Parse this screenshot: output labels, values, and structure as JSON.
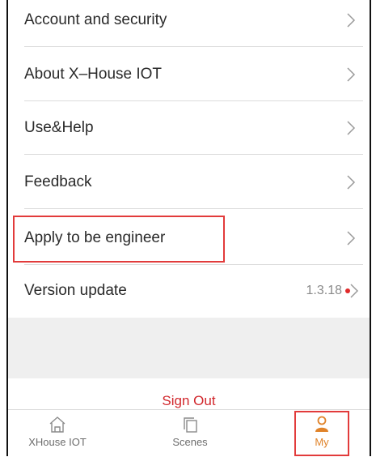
{
  "menu": {
    "items": [
      {
        "label": "Account and security"
      },
      {
        "label": "About X–House IOT"
      },
      {
        "label": "Use&Help"
      },
      {
        "label": "Feedback"
      },
      {
        "label": "Apply to be engineer"
      },
      {
        "label": "Version update",
        "value": "1.3.18",
        "has_update_dot": true
      }
    ]
  },
  "sign_out_label": "Sign Out",
  "tabbar": {
    "tabs": [
      {
        "label": "XHouse IOT",
        "icon": "home-icon",
        "active": false
      },
      {
        "label": "Scenes",
        "icon": "scenes-icon",
        "active": false
      },
      {
        "label": "My",
        "icon": "profile-icon",
        "active": true
      }
    ]
  },
  "colors": {
    "accent_red": "#d1262b",
    "active_tab": "#e0832a",
    "highlight_box": "#e23b3b"
  }
}
